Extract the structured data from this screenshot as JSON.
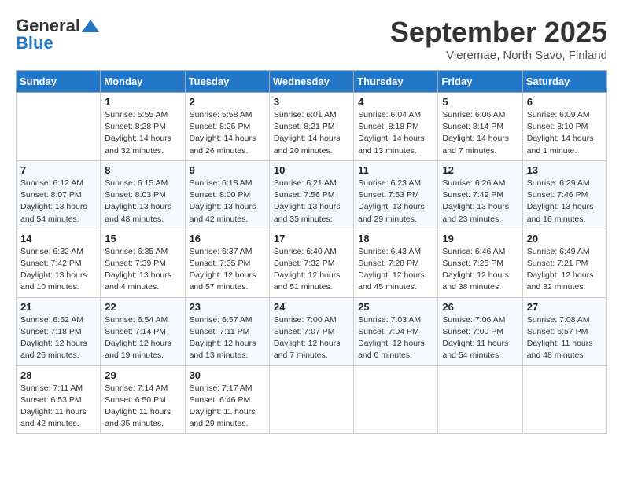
{
  "header": {
    "logo_general": "General",
    "logo_blue": "Blue",
    "month_title": "September 2025",
    "location": "Vieremae, North Savo, Finland"
  },
  "days_of_week": [
    "Sunday",
    "Monday",
    "Tuesday",
    "Wednesday",
    "Thursday",
    "Friday",
    "Saturday"
  ],
  "weeks": [
    [
      {
        "day": "",
        "info": ""
      },
      {
        "day": "1",
        "info": "Sunrise: 5:55 AM\nSunset: 8:28 PM\nDaylight: 14 hours\nand 32 minutes."
      },
      {
        "day": "2",
        "info": "Sunrise: 5:58 AM\nSunset: 8:25 PM\nDaylight: 14 hours\nand 26 minutes."
      },
      {
        "day": "3",
        "info": "Sunrise: 6:01 AM\nSunset: 8:21 PM\nDaylight: 14 hours\nand 20 minutes."
      },
      {
        "day": "4",
        "info": "Sunrise: 6:04 AM\nSunset: 8:18 PM\nDaylight: 14 hours\nand 13 minutes."
      },
      {
        "day": "5",
        "info": "Sunrise: 6:06 AM\nSunset: 8:14 PM\nDaylight: 14 hours\nand 7 minutes."
      },
      {
        "day": "6",
        "info": "Sunrise: 6:09 AM\nSunset: 8:10 PM\nDaylight: 14 hours\nand 1 minute."
      }
    ],
    [
      {
        "day": "7",
        "info": "Sunrise: 6:12 AM\nSunset: 8:07 PM\nDaylight: 13 hours\nand 54 minutes."
      },
      {
        "day": "8",
        "info": "Sunrise: 6:15 AM\nSunset: 8:03 PM\nDaylight: 13 hours\nand 48 minutes."
      },
      {
        "day": "9",
        "info": "Sunrise: 6:18 AM\nSunset: 8:00 PM\nDaylight: 13 hours\nand 42 minutes."
      },
      {
        "day": "10",
        "info": "Sunrise: 6:21 AM\nSunset: 7:56 PM\nDaylight: 13 hours\nand 35 minutes."
      },
      {
        "day": "11",
        "info": "Sunrise: 6:23 AM\nSunset: 7:53 PM\nDaylight: 13 hours\nand 29 minutes."
      },
      {
        "day": "12",
        "info": "Sunrise: 6:26 AM\nSunset: 7:49 PM\nDaylight: 13 hours\nand 23 minutes."
      },
      {
        "day": "13",
        "info": "Sunrise: 6:29 AM\nSunset: 7:46 PM\nDaylight: 13 hours\nand 16 minutes."
      }
    ],
    [
      {
        "day": "14",
        "info": "Sunrise: 6:32 AM\nSunset: 7:42 PM\nDaylight: 13 hours\nand 10 minutes."
      },
      {
        "day": "15",
        "info": "Sunrise: 6:35 AM\nSunset: 7:39 PM\nDaylight: 13 hours\nand 4 minutes."
      },
      {
        "day": "16",
        "info": "Sunrise: 6:37 AM\nSunset: 7:35 PM\nDaylight: 12 hours\nand 57 minutes."
      },
      {
        "day": "17",
        "info": "Sunrise: 6:40 AM\nSunset: 7:32 PM\nDaylight: 12 hours\nand 51 minutes."
      },
      {
        "day": "18",
        "info": "Sunrise: 6:43 AM\nSunset: 7:28 PM\nDaylight: 12 hours\nand 45 minutes."
      },
      {
        "day": "19",
        "info": "Sunrise: 6:46 AM\nSunset: 7:25 PM\nDaylight: 12 hours\nand 38 minutes."
      },
      {
        "day": "20",
        "info": "Sunrise: 6:49 AM\nSunset: 7:21 PM\nDaylight: 12 hours\nand 32 minutes."
      }
    ],
    [
      {
        "day": "21",
        "info": "Sunrise: 6:52 AM\nSunset: 7:18 PM\nDaylight: 12 hours\nand 26 minutes."
      },
      {
        "day": "22",
        "info": "Sunrise: 6:54 AM\nSunset: 7:14 PM\nDaylight: 12 hours\nand 19 minutes."
      },
      {
        "day": "23",
        "info": "Sunrise: 6:57 AM\nSunset: 7:11 PM\nDaylight: 12 hours\nand 13 minutes."
      },
      {
        "day": "24",
        "info": "Sunrise: 7:00 AM\nSunset: 7:07 PM\nDaylight: 12 hours\nand 7 minutes."
      },
      {
        "day": "25",
        "info": "Sunrise: 7:03 AM\nSunset: 7:04 PM\nDaylight: 12 hours\nand 0 minutes."
      },
      {
        "day": "26",
        "info": "Sunrise: 7:06 AM\nSunset: 7:00 PM\nDaylight: 11 hours\nand 54 minutes."
      },
      {
        "day": "27",
        "info": "Sunrise: 7:08 AM\nSunset: 6:57 PM\nDaylight: 11 hours\nand 48 minutes."
      }
    ],
    [
      {
        "day": "28",
        "info": "Sunrise: 7:11 AM\nSunset: 6:53 PM\nDaylight: 11 hours\nand 42 minutes."
      },
      {
        "day": "29",
        "info": "Sunrise: 7:14 AM\nSunset: 6:50 PM\nDaylight: 11 hours\nand 35 minutes."
      },
      {
        "day": "30",
        "info": "Sunrise: 7:17 AM\nSunset: 6:46 PM\nDaylight: 11 hours\nand 29 minutes."
      },
      {
        "day": "",
        "info": ""
      },
      {
        "day": "",
        "info": ""
      },
      {
        "day": "",
        "info": ""
      },
      {
        "day": "",
        "info": ""
      }
    ]
  ]
}
